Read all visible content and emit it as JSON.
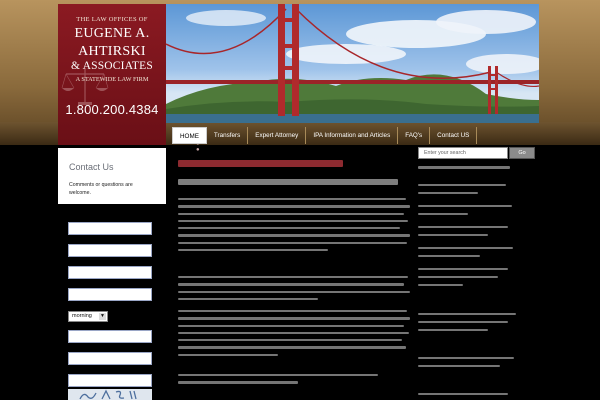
{
  "logo": {
    "top_line": "THE LAW OFFICES OF",
    "name_line1": "EUGENE A.",
    "name_line2": "AHTIRSKI",
    "name_line3": "& ASSOCIATES",
    "tagline": "A STATEWIDE LAW FIRM",
    "phone": "1.800.200.4384"
  },
  "banner": {
    "image": "golden-gate-bridge-photo"
  },
  "nav": {
    "items": [
      {
        "label": "HOME",
        "active": true
      },
      {
        "label": "Transfers",
        "active": false
      },
      {
        "label": "Expert Attorney",
        "active": false
      },
      {
        "label": "IPA Information and Articles",
        "active": false
      },
      {
        "label": "FAQ's",
        "active": false
      },
      {
        "label": "Contact US",
        "active": false
      }
    ]
  },
  "contact": {
    "title": "Contact Us",
    "text": "Comments or questions are welcome.",
    "time_select_value": "morning"
  },
  "search": {
    "placeholder": "Enter your search",
    "button_label": "Go"
  },
  "colors": {
    "accent_red": "#8b1a22",
    "header_tan": "#b8945e",
    "background": "#000000"
  }
}
